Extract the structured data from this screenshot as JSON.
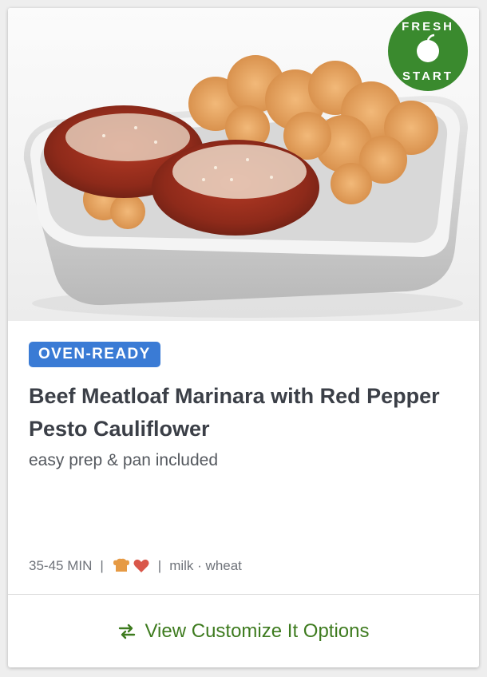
{
  "badge": {
    "line1": "FRESH",
    "line2": "START",
    "color": "#3a8a2e"
  },
  "card": {
    "tag": "OVEN-READY",
    "tag_color": "#3a7bd5",
    "title": "Beef Meatloaf Marinara with Red Pepper Pesto Cauliflower",
    "subtitle": "easy prep & pan included",
    "meta": {
      "time": "35-45 MIN",
      "separator": "|",
      "icons": [
        "chef-hat-icon",
        "heart-icon"
      ],
      "allergens": "milk · wheat"
    }
  },
  "footer": {
    "icon": "swap-arrows-icon",
    "label": "View Customize It Options",
    "color": "#3e7b1f"
  }
}
